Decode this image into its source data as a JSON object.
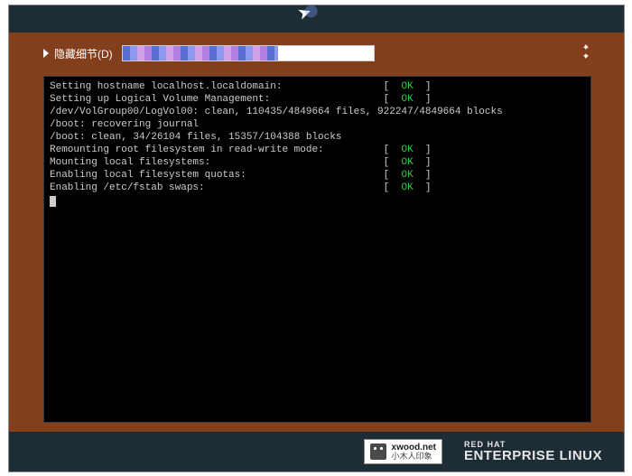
{
  "details_toggle_label": "隐藏细节(D)",
  "progress_percent": 62,
  "boot_lines": [
    {
      "text": "Setting hostname localhost.localdomain:",
      "status": "OK"
    },
    {
      "text": "Setting up Logical Volume Management:",
      "status": "OK"
    },
    {
      "text": "/dev/VolGroup00/LogVol00: clean, 110435/4849664 files, 922247/4849664 blocks",
      "status": null
    },
    {
      "text": "/boot: recovering journal",
      "status": null
    },
    {
      "text": "/boot: clean, 34/26104 files, 15357/104388 blocks",
      "status": null
    },
    {
      "text": "Remounting root filesystem in read-write mode:",
      "status": "OK"
    },
    {
      "text": "Mounting local filesystems:",
      "status": "OK"
    },
    {
      "text": "Enabling local filesystem quotas:",
      "status": "OK"
    },
    {
      "text": "Enabling /etc/fstab swaps:",
      "status": "OK"
    }
  ],
  "status_column": 56,
  "watermark": {
    "line1": "xwood.net",
    "line2": "小木人印象"
  },
  "brand": {
    "line1": "RED HAT",
    "line2": "ENTERPRISE LINUX"
  },
  "colors": {
    "frame": "#833e1b",
    "panel": "#1e2c36",
    "ok": "#2ecc40"
  }
}
